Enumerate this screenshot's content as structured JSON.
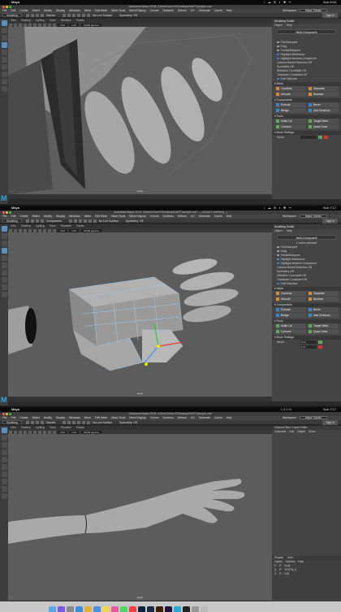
{
  "mac_menubar": {
    "app": "Maya",
    "status": "♪ ☁ ⊕ ◐ ✱ ᯤ",
    "battery": "100%",
    "times": [
      "Sun 9:04",
      "Sun 7:17",
      "Sun 7:17"
    ]
  },
  "window_titles": [
    "Autodesk Maya 2018: /Users/ChenYi/Desktop/DART/people.ma*",
    "Autodesk Maya 2018: /Users/ChenYi/Desktop/DART/people.ma* --- pCube1.vtxFace[...]",
    "Autodesk Maya 2018: /Users/ChenYi/Desktop/DART/people.ma*"
  ],
  "menus": [
    "File",
    "Edit",
    "Create",
    "Select",
    "Modify",
    "Display",
    "Windows",
    "Mesh",
    "Edit Mesh",
    "Mesh Tools",
    "Mesh Display",
    "Curves",
    "Surfaces",
    "Deform",
    "UV",
    "Generate",
    "Cache",
    "Help"
  ],
  "workspace": {
    "label": "Workspace:",
    "value": "Maya Classic"
  },
  "statusline": {
    "mode": "Modeling",
    "objects": "Objects",
    "components": "Components",
    "no_live": "No Live Surface",
    "symmetry": "Symmetry: Off",
    "sign_in": "Sign In"
  },
  "panel_menu": [
    "View",
    "Shading",
    "Lighting",
    "Show",
    "Renderer",
    "Panels"
  ],
  "viewport": {
    "camera": "persp",
    "exposure": "0.00",
    "gamma": "1.00",
    "colorspace": "sRGB gamma"
  },
  "toolkit": {
    "title": "Modeling Toolkit",
    "tabs": [
      "Object",
      "Help"
    ],
    "multi_component": "Multi-Component",
    "vertex_selected": "1 vertex selected",
    "pick_marquee": "Pick/Marquee",
    "drag": "Drag",
    "tweak_marquee": "Tweak/Marquee",
    "highlight_backfaces": "Highlight Backfaces",
    "highlight_nearest": "Highlight Nearest Component",
    "camera_selection": "Camera Based Selection",
    "symmetry": "Symmetry",
    "selection_constraint": "Selection Constraint",
    "transform_constraint": "Transform Constraint",
    "off": "Off",
    "soft_selection": "Soft Selection",
    "section_mesh": "Mesh",
    "section_components": "Components",
    "section_tools": "Tools",
    "section_move": "Move Settings",
    "mesh_buttons": [
      [
        "Combine",
        "Separate"
      ],
      [
        "Smooth",
        "Boolean"
      ]
    ],
    "component_buttons": [
      [
        "Extrude",
        "Bevel"
      ],
      [
        "Bridge",
        "Add Divisions"
      ]
    ],
    "tool_buttons": [
      [
        "Multi-Cut",
        "Target Weld"
      ],
      [
        "Connect",
        "Quad Draw"
      ]
    ],
    "world_label": "World",
    "world_values": [
      "0.13",
      "4.47"
    ]
  },
  "channel_box": {
    "tabs": [
      "Channels",
      "Edit",
      "Object",
      "Show"
    ],
    "header": "Channel Box / Layer Editor"
  },
  "layer_editor": {
    "tabs": [
      "Display",
      "Anim"
    ],
    "menu": [
      "Layers",
      "Options",
      "Help"
    ],
    "layers": [
      {
        "v": "V",
        "p": "P",
        "name": "body"
      },
      {
        "v": "V",
        "p": "P",
        "name": "TESTN_h"
      },
      {
        "v": "V",
        "p": "P",
        "name": "DIS"
      }
    ]
  },
  "dock_icons": [
    "finder-icon",
    "siri-icon",
    "launchpad-icon",
    "safari-icon",
    "chrome-icon",
    "mail-icon",
    "notes-icon",
    "photos-icon",
    "messages-icon",
    "music-icon",
    "photoshop-icon",
    "lightroom-icon",
    "illustrator-icon",
    "aftereffects-icon",
    "maya-icon",
    "terminal-icon",
    "settings-icon",
    "trash-icon"
  ],
  "colors": {
    "accent": "#3d82c4",
    "maya_logo": "#2aa9d6",
    "viewport_bg": "#5c5c5c",
    "panel_bg": "#444444"
  }
}
